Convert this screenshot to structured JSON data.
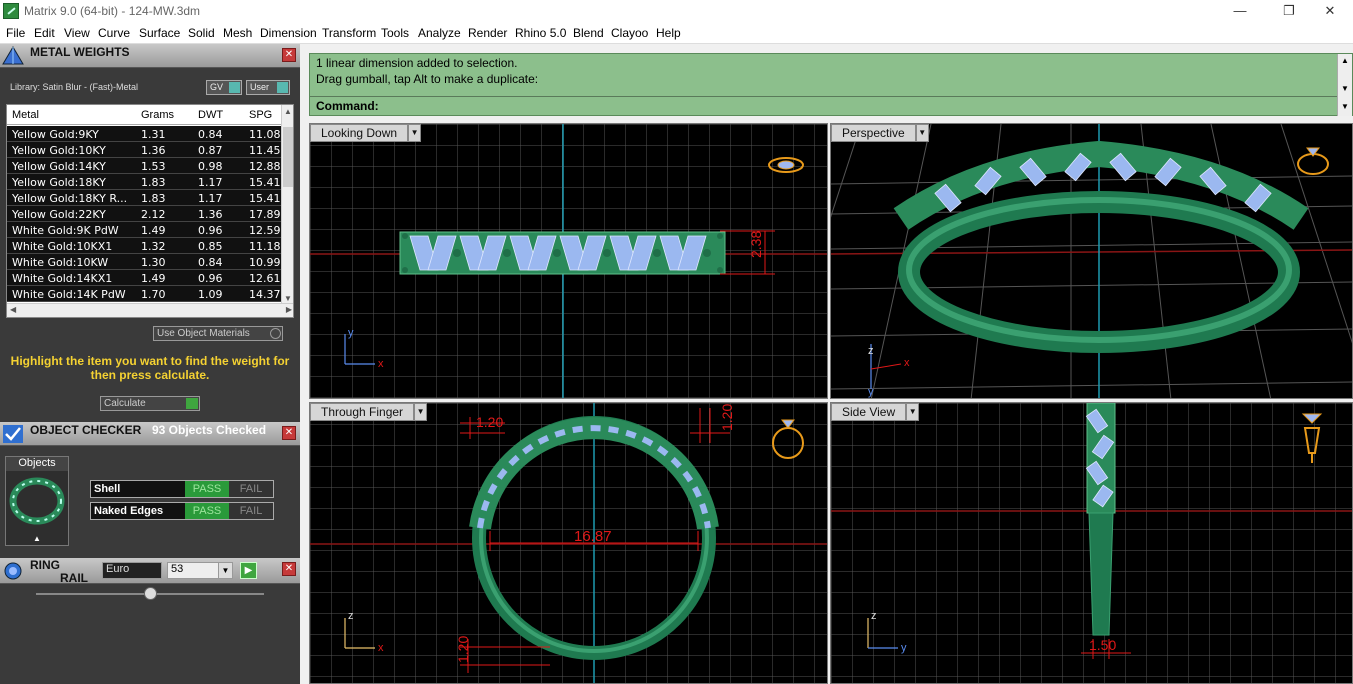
{
  "window": {
    "title": "Matrix 9.0 (64-bit) - 124-MW.3dm",
    "min": "—",
    "restore": "❐",
    "close": "✕"
  },
  "menu": [
    "File",
    "Edit",
    "View",
    "Curve",
    "Surface",
    "Solid",
    "Mesh",
    "Dimension",
    "Transform",
    "Tools",
    "Analyze",
    "Render",
    "Rhino 5.0",
    "Blend",
    "Clayoo",
    "Help"
  ],
  "metal_weights": {
    "title": "METAL WEIGHTS",
    "library": "Library: Satin Blur - (Fast)-Metal",
    "gv": "GV",
    "user": "User",
    "columns": [
      "Metal",
      "Grams",
      "DWT",
      "SPG"
    ],
    "rows": [
      [
        "Yellow Gold:9KY",
        "1.31",
        "0.84",
        "11.08"
      ],
      [
        "Yellow Gold:10KY",
        "1.36",
        "0.87",
        "11.45"
      ],
      [
        "Yellow Gold:14KY",
        "1.53",
        "0.98",
        "12.88"
      ],
      [
        "Yellow Gold:18KY",
        "1.83",
        "1.17",
        "15.41"
      ],
      [
        "Yellow Gold:18KY R...",
        "1.83",
        "1.17",
        "15.41"
      ],
      [
        "Yellow Gold:22KY",
        "2.12",
        "1.36",
        "17.89"
      ],
      [
        "White Gold:9K PdW",
        "1.49",
        "0.96",
        "12.59"
      ],
      [
        "White Gold:10KX1",
        "1.32",
        "0.85",
        "11.18"
      ],
      [
        "White Gold:10KW",
        "1.30",
        "0.84",
        "10.99"
      ],
      [
        "White Gold:14KX1",
        "1.49",
        "0.96",
        "12.61"
      ],
      [
        "White Gold:14K PdW",
        "1.70",
        "1.09",
        "14.37"
      ]
    ],
    "use_object_materials": "Use Object Materials",
    "hint": "Highlight the item you want to find the weight for then press calculate.",
    "calculate": "Calculate"
  },
  "object_checker": {
    "title": "OBJECT CHECKER",
    "count": "93  Objects Checked",
    "objects_label": "Objects",
    "shell": "Shell",
    "naked_edges": "Naked Edges",
    "pass": "PASS",
    "fail": "FAIL"
  },
  "ring_rail": {
    "title_1": "RING",
    "title_2": "RAIL",
    "standard": "Euro",
    "size": "53"
  },
  "command": {
    "line1": "1 linear dimension added to selection.",
    "line2": "Drag gumball, tap Alt to make a duplicate:",
    "prompt": "Command:"
  },
  "viewports": {
    "top_left": {
      "label": "Looking Down",
      "dim": "2.38"
    },
    "top_right": {
      "label": "Perspective"
    },
    "bottom_left": {
      "label": "Through Finger",
      "dim_width": "16.87",
      "dim_top1": "1.20",
      "dim_top2": "1.20",
      "dim_bottom": "1.20"
    },
    "bottom_right": {
      "label": "Side View",
      "dim": "1.50"
    }
  },
  "colors": {
    "ring": "#2a8a5a",
    "stone": "#9bb8f0",
    "grid": "#5a5a5a",
    "dimension": "#e01818",
    "axis": "#1e9ab0"
  }
}
